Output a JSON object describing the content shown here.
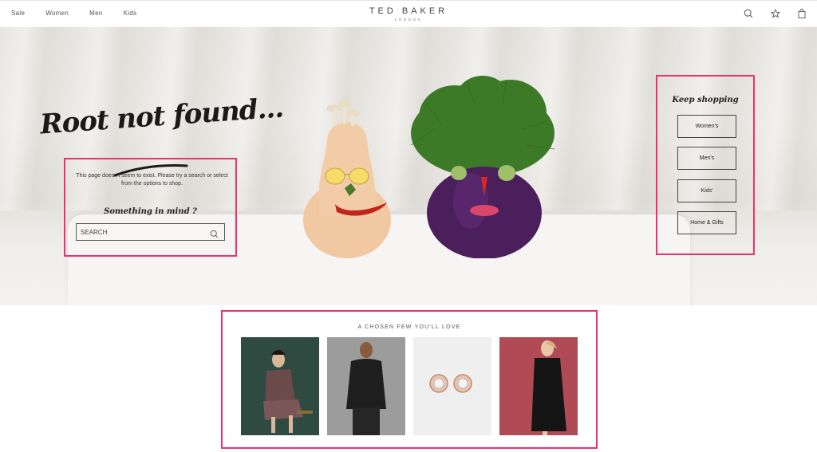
{
  "nav": {
    "items": [
      {
        "label": "Sale"
      },
      {
        "label": "Women"
      },
      {
        "label": "Men"
      },
      {
        "label": "Kids"
      }
    ]
  },
  "brand": {
    "name": "TED BAKER",
    "sub": "LONDON"
  },
  "header_icons": [
    "search-icon",
    "wishlist-star-icon",
    "shopping-bag-icon"
  ],
  "hero": {
    "headline": "Root not found...",
    "message": "This page doesn't seem to exist. Please try a search or select from the options to shop.",
    "search_title": "Something in mind ?",
    "search_placeholder": "SEARCH"
  },
  "keep_shopping": {
    "title": "Keep shopping",
    "buttons": [
      {
        "label": "Women's"
      },
      {
        "label": "Men's"
      },
      {
        "label": "Kids'"
      },
      {
        "label": "Home & Gifts"
      }
    ]
  },
  "chosen": {
    "title": "A CHOSEN FEW YOU'LL LOVE",
    "products": [
      {
        "desc": "woman-in-tweed-jacket-and-skirt"
      },
      {
        "desc": "man-in-black-sweater"
      },
      {
        "desc": "rose-gold-stud-earrings"
      },
      {
        "desc": "woman-in-black-coat"
      }
    ]
  },
  "colors": {
    "highlight": "#f0306e",
    "text": "#222222"
  }
}
